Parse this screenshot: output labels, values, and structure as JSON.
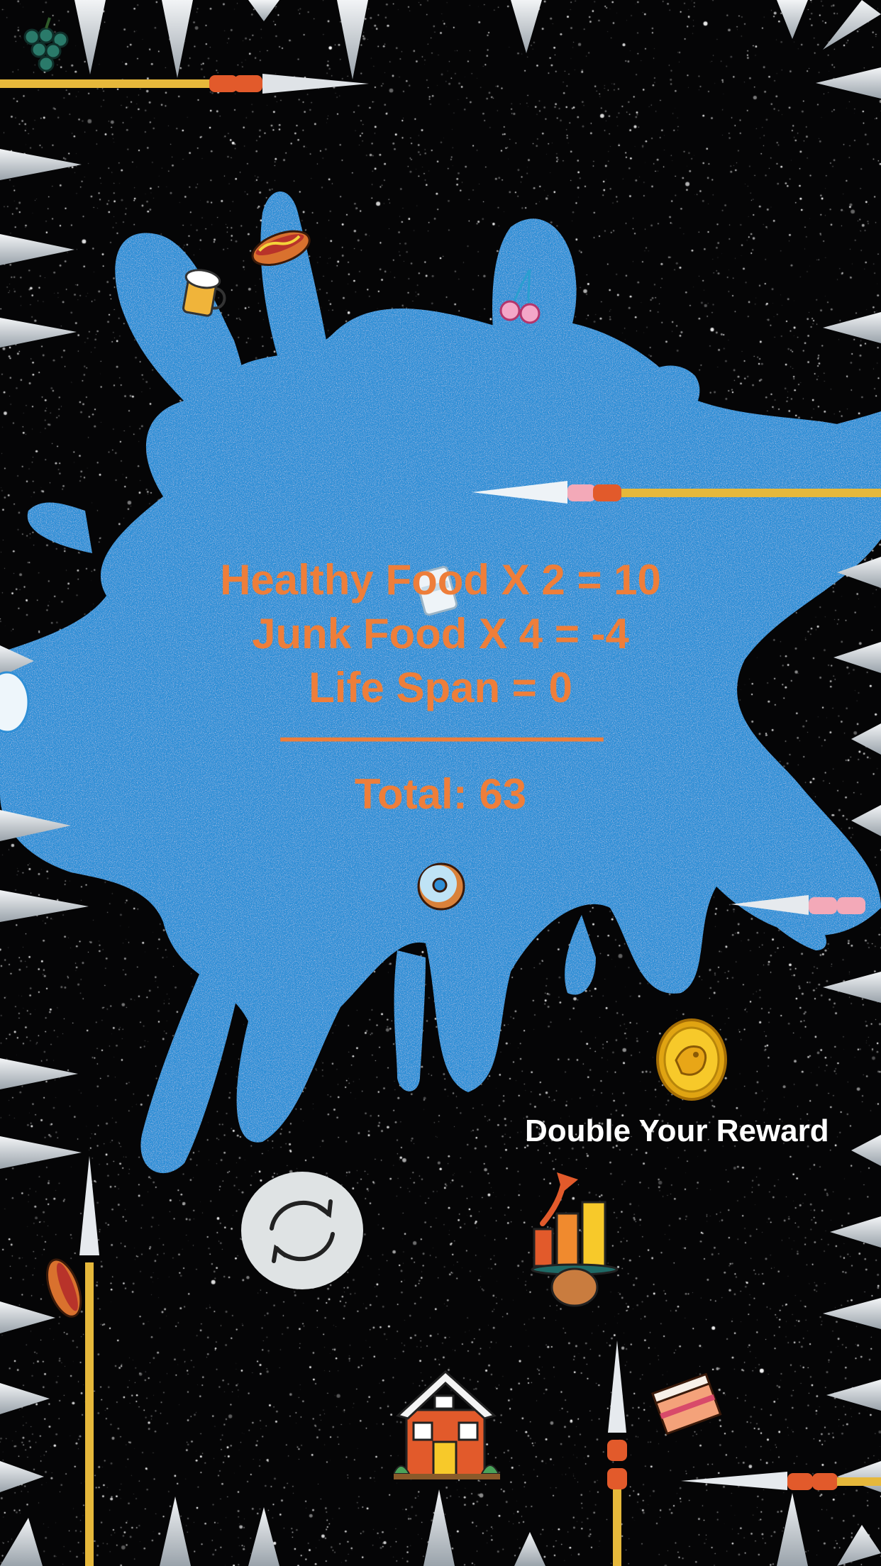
{
  "results": {
    "healthy_line": "Healthy Food X 2 = 10",
    "junk_line": "Junk Food X 4 = -4",
    "lifespan_line": "Life Span = 0",
    "divider": "--------------------------------------",
    "total_line": "Total: 63"
  },
  "reward": {
    "label": "Double Your Reward",
    "coin_icon": "gold-coin-icon"
  },
  "controls": {
    "replay_icon": "replay-icon",
    "boost_icon": "score-boost-icon",
    "home_icon": "home-icon"
  },
  "colors": {
    "background": "#050506",
    "splat": "#2f8fd6",
    "score_text": "#ee7e3a",
    "label_text": "#ffffff",
    "spike": "#d8dde2"
  },
  "foods": [
    "grapes",
    "beer",
    "hotdog",
    "cherries",
    "drink",
    "donut",
    "hotdog",
    "cake"
  ]
}
